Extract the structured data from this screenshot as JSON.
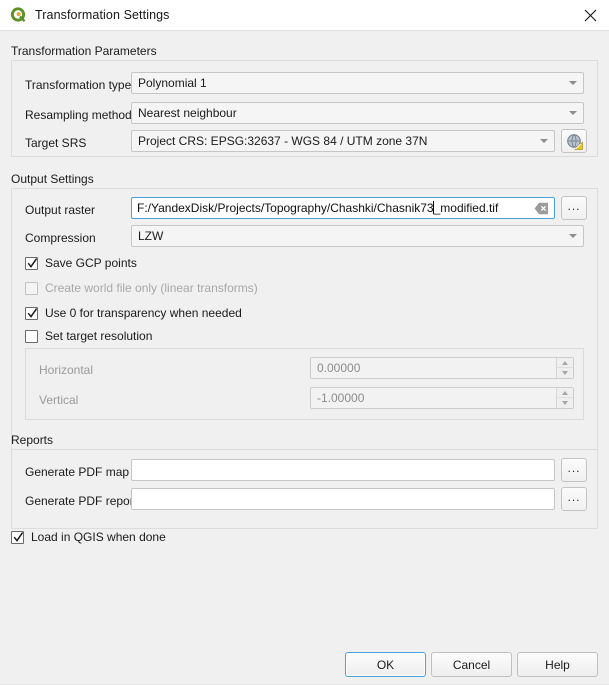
{
  "window": {
    "title": "Transformation Settings",
    "icon": "qgis-logo-icon",
    "close_icon": "close-icon"
  },
  "transformation_parameters": {
    "section_label": "Transformation Parameters",
    "transformation_type": {
      "label": "Transformation type",
      "value": "Polynomial 1"
    },
    "resampling_method": {
      "label": "Resampling method",
      "value": "Nearest neighbour"
    },
    "target_srs": {
      "label": "Target SRS",
      "value": "Project CRS: EPSG:32637 - WGS 84 / UTM zone 37N",
      "select_button_icon": "globe-crs-icon"
    }
  },
  "output_settings": {
    "section_label": "Output Settings",
    "output_raster": {
      "label": "Output raster",
      "value_before_caret": "F:/YandexDisk/Projects/Topography/Chashki/Chasnik73",
      "value_after_caret": "_modified.tif",
      "full_value": "F:/YandexDisk/Projects/Topography/Chashki/Chasnik73_modified.tif",
      "clear_icon": "clear-field-icon",
      "browse_label": "..."
    },
    "compression": {
      "label": "Compression",
      "value": "LZW"
    },
    "checkboxes": [
      {
        "label": "Save GCP points",
        "checked": true,
        "enabled": true
      },
      {
        "label": "Create world file only (linear transforms)",
        "checked": false,
        "enabled": false
      },
      {
        "label": "Use 0 for transparency when needed",
        "checked": true,
        "enabled": true
      },
      {
        "label": "Set target resolution",
        "checked": false,
        "enabled": true
      }
    ],
    "resolution": {
      "horizontal": {
        "label": "Horizontal",
        "value": "0.00000"
      },
      "vertical": {
        "label": "Vertical",
        "value": "-1.00000"
      }
    }
  },
  "reports": {
    "section_label": "Reports",
    "pdf_map": {
      "label": "Generate PDF map",
      "value": "",
      "browse_label": "..."
    },
    "pdf_report": {
      "label": "Generate PDF report",
      "value": "",
      "browse_label": "..."
    }
  },
  "load_in_qgis": {
    "label": "Load in QGIS when done",
    "checked": true
  },
  "buttons": {
    "ok": "OK",
    "cancel": "Cancel",
    "help": "Help"
  },
  "colors": {
    "accent": "#4aa3df",
    "qgis_green": "#5a9324",
    "qgis_orange": "#e8a33d",
    "background": "#f0f0f0",
    "titlebar": "#ffffff"
  }
}
